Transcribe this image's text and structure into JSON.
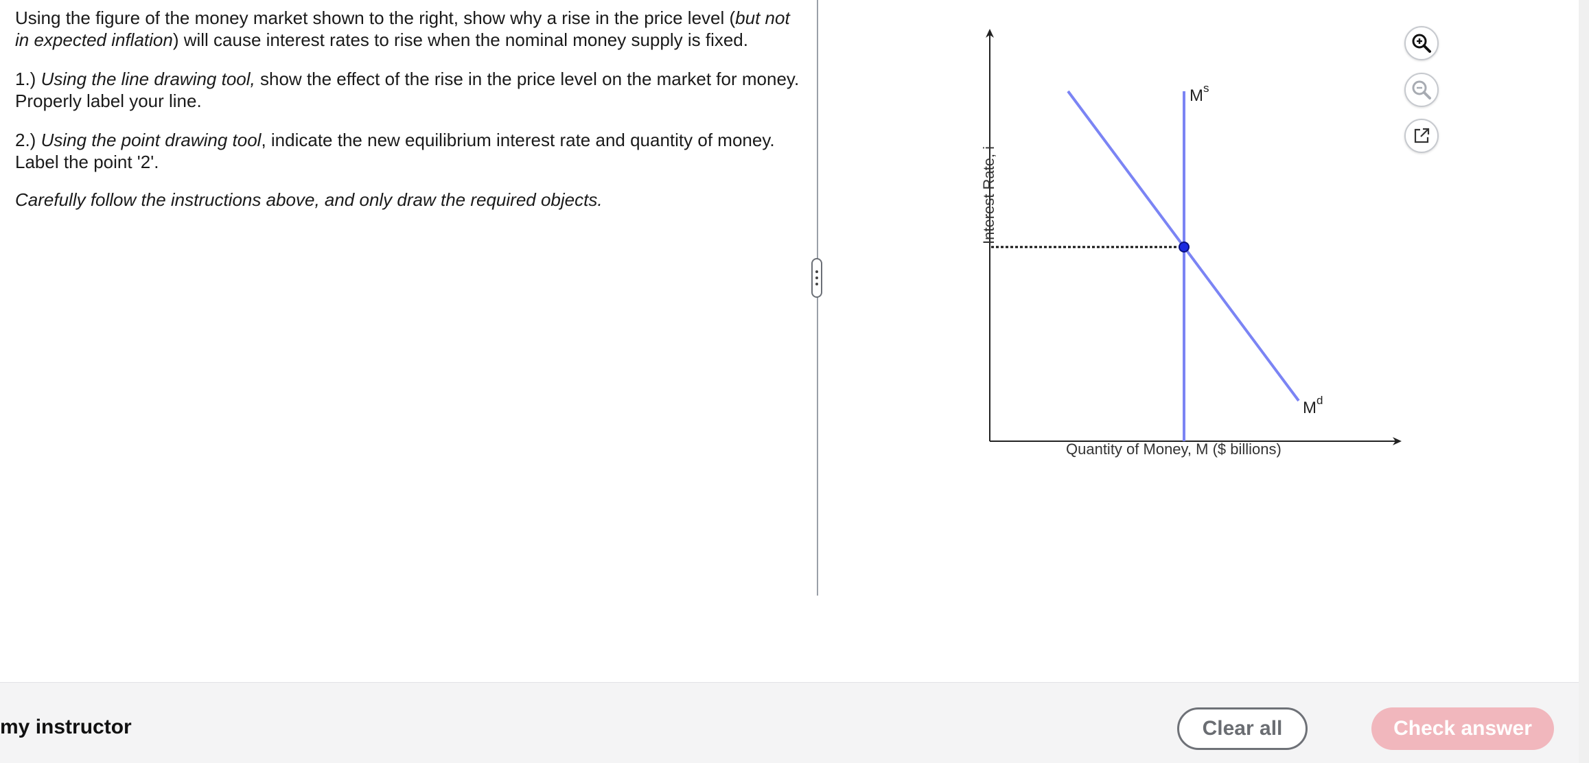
{
  "question": {
    "intro_part1": "Using the figure of the money market shown to the right, show why a rise in the price level (",
    "intro_italic": "but not in expected inflation",
    "intro_part2": ") will cause interest rates to rise when the nominal money supply is fixed.",
    "step1_prefix": "1.) ",
    "step1_italic": "Using the line drawing tool,",
    "step1_rest": " show the effect of the rise in the price level on the market for money. Properly label your line.",
    "step2_prefix": "2.) ",
    "step2_italic": "Using the point drawing tool",
    "step2_rest": ", indicate the new equilibrium interest rate and quantity of money. Label the point '2'.",
    "note": "Carefully follow the instructions above, and only draw the required objects."
  },
  "graph": {
    "y_axis_label": "Interest Rate, i",
    "x_axis_label": "Quantity of Money, M ($ billions)",
    "supply_label_base": "M",
    "supply_label_sup": "s",
    "demand_label_base": "M",
    "demand_label_sup": "d",
    "line_color": "#7b84f4",
    "point_color": "#1b2ae0",
    "axis_color": "#222222"
  },
  "tools": {
    "zoom_in": "zoom-in-icon",
    "zoom_out": "zoom-out-icon",
    "popout": "external-link-icon"
  },
  "footer": {
    "instructor_text": "my instructor",
    "clear_label": "Clear all",
    "check_label": "Check answer",
    "check_color": "#f1b7bd"
  }
}
